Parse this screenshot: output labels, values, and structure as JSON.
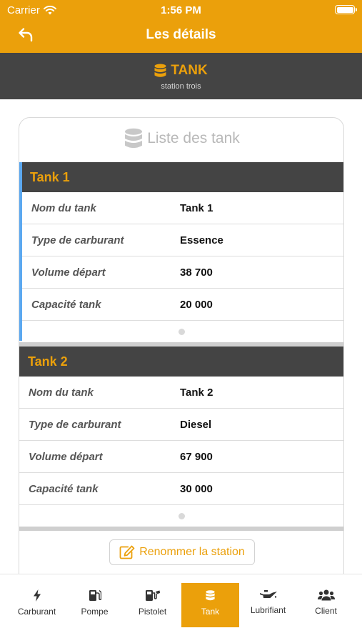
{
  "status_bar": {
    "carrier": "Carrier",
    "time": "1:56 PM"
  },
  "header": {
    "title": "Les détails"
  },
  "band": {
    "title": "TANK",
    "subtitle": "station trois"
  },
  "card": {
    "title": "Liste des tank",
    "tanks": [
      {
        "name": "Tank 1",
        "rows": [
          {
            "label": "Nom du tank",
            "value": "Tank 1"
          },
          {
            "label": "Type de carburant",
            "value": "Essence"
          },
          {
            "label": "Volume départ",
            "value": "38 700"
          },
          {
            "label": "Capacité tank",
            "value": "20 000"
          }
        ]
      },
      {
        "name": "Tank 2",
        "rows": [
          {
            "label": "Nom du tank",
            "value": "Tank 2"
          },
          {
            "label": "Type de carburant",
            "value": "Diesel"
          },
          {
            "label": "Volume départ",
            "value": "67 900"
          },
          {
            "label": "Capacité tank",
            "value": "30 000"
          }
        ]
      }
    ],
    "rename_label": "Renommer la station"
  },
  "tabs": [
    {
      "label": "Carburant",
      "icon": "bolt-icon",
      "active": false
    },
    {
      "label": "Pompe",
      "icon": "gas-pump-icon",
      "active": false
    },
    {
      "label": "Pistolet",
      "icon": "fuel-nozzle-icon",
      "active": false
    },
    {
      "label": "Tank",
      "icon": "database-icon",
      "active": true
    },
    {
      "label": "Lubrifiant",
      "icon": "oil-can-icon",
      "active": false
    },
    {
      "label": "Client",
      "icon": "users-icon",
      "active": false
    }
  ],
  "colors": {
    "accent": "#EBA00B",
    "dark": "#444444",
    "selected_border": "#5BA8F0"
  }
}
